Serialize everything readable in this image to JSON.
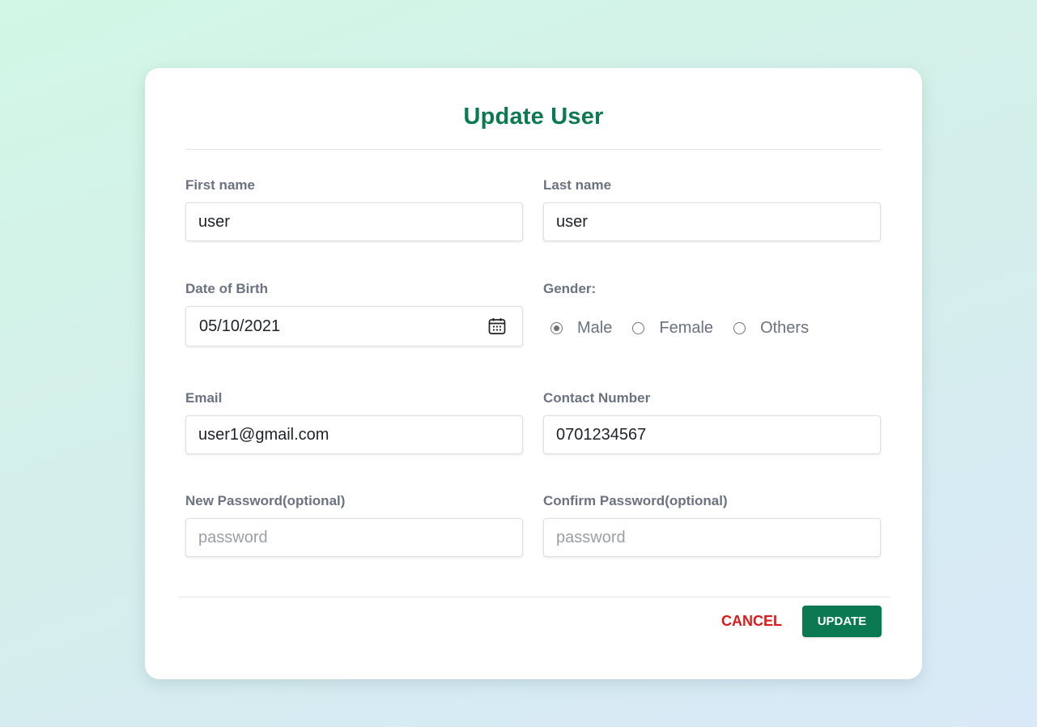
{
  "form": {
    "title": "Update User",
    "fields": {
      "first_name": {
        "label": "First name",
        "value": "user"
      },
      "last_name": {
        "label": "Last name",
        "value": "user"
      },
      "dob": {
        "label": "Date of Birth",
        "value": "05/10/2021",
        "icon": "calendar-icon"
      },
      "gender": {
        "label": "Gender:",
        "options": [
          "Male",
          "Female",
          "Others"
        ],
        "selected": "Male"
      },
      "email": {
        "label": "Email",
        "value": "user1@gmail.com"
      },
      "contact": {
        "label": "Contact Number",
        "value": "0701234567"
      },
      "new_password": {
        "label": "New Password(optional)",
        "value": "",
        "placeholder": "password"
      },
      "confirm_password": {
        "label": "Confirm Password(optional)",
        "value": "",
        "placeholder": "password"
      }
    },
    "buttons": {
      "cancel": "CANCEL",
      "update": "UPDATE"
    }
  },
  "colors": {
    "accent": "#0b7a53",
    "danger": "#d81b1b",
    "label": "#6b7280"
  }
}
